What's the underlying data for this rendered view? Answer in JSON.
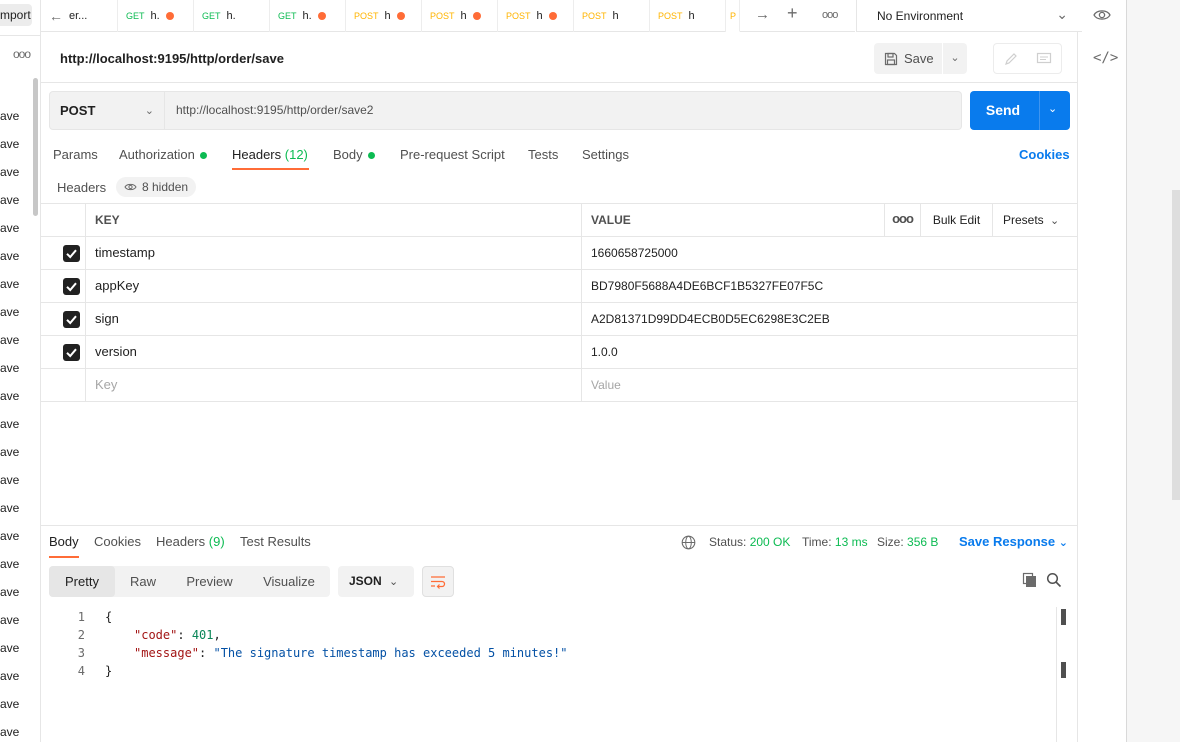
{
  "sidebar": {
    "import_label": "mport",
    "more": "ooo",
    "items": [
      "ave",
      "ave",
      "ave",
      "ave",
      "ave",
      "ave",
      "ave",
      "ave",
      "ave",
      "ave",
      "ave",
      "ave",
      "ave",
      "ave",
      "ave",
      "ave",
      "ave",
      "ave",
      "ave",
      "ave",
      "ave",
      "ave",
      "ave"
    ]
  },
  "tabs": [
    {
      "method": "",
      "title": "er...",
      "unsaved": false
    },
    {
      "method": "GET",
      "title": "h.",
      "unsaved": true
    },
    {
      "method": "GET",
      "title": "h.",
      "unsaved": false
    },
    {
      "method": "GET",
      "title": "h.",
      "unsaved": true
    },
    {
      "method": "POST",
      "title": "h",
      "unsaved": true
    },
    {
      "method": "POST",
      "title": "h",
      "unsaved": true
    },
    {
      "method": "POST",
      "title": "h",
      "unsaved": true
    },
    {
      "method": "POST",
      "title": "h",
      "unsaved": false
    },
    {
      "method": "POST",
      "title": "h",
      "unsaved": false
    },
    {
      "method": "P",
      "title": "",
      "unsaved": false
    }
  ],
  "environment": {
    "label": "No Environment"
  },
  "request": {
    "title": "http://localhost:9195/http/order/save",
    "save_label": "Save",
    "method": "POST",
    "url": "http://localhost:9195/http/order/save2",
    "send_label": "Send"
  },
  "request_tabs": {
    "params": "Params",
    "authorization": "Authorization",
    "headers": "Headers",
    "headers_count": "(12)",
    "body": "Body",
    "prerequest": "Pre-request Script",
    "tests": "Tests",
    "settings": "Settings",
    "cookies": "Cookies"
  },
  "headers_section": {
    "label": "Headers",
    "hidden": "8 hidden",
    "col_key": "KEY",
    "col_value": "VALUE",
    "more": "ooo",
    "bulk_edit": "Bulk Edit",
    "presets": "Presets",
    "rows": [
      {
        "key": "timestamp",
        "value": "1660658725000",
        "checked": true
      },
      {
        "key": "appKey",
        "value": "BD7980F5688A4DE6BCF1B5327FE07F5C",
        "checked": true
      },
      {
        "key": "sign",
        "value": "A2D81371D99DD4ECB0D5EC6298E3C2EB",
        "checked": true
      },
      {
        "key": "version",
        "value": "1.0.0",
        "checked": true
      }
    ],
    "key_placeholder": "Key",
    "value_placeholder": "Value"
  },
  "response": {
    "tabs": {
      "body": "Body",
      "cookies": "Cookies",
      "headers": "Headers",
      "headers_count": "(9)",
      "test_results": "Test Results"
    },
    "status_label": "Status:",
    "status_value": "200 OK",
    "time_label": "Time:",
    "time_value": "13 ms",
    "size_label": "Size:",
    "size_value": "356 B",
    "save_response": "Save Response",
    "views": [
      "Pretty",
      "Raw",
      "Preview",
      "Visualize"
    ],
    "format": "JSON",
    "lines": [
      "1",
      "2",
      "3",
      "4"
    ],
    "body": {
      "open": "{",
      "code_key": "\"code\"",
      "code_value": "401",
      "message_key": "\"message\"",
      "message_value": "\"The signature timestamp has exceeded 5 minutes!\"",
      "close": "}"
    }
  },
  "colors": {
    "accent": "#097bed",
    "get": "#0cbb52",
    "post": "#ffb400",
    "tab_indicator": "#ff6c37"
  }
}
